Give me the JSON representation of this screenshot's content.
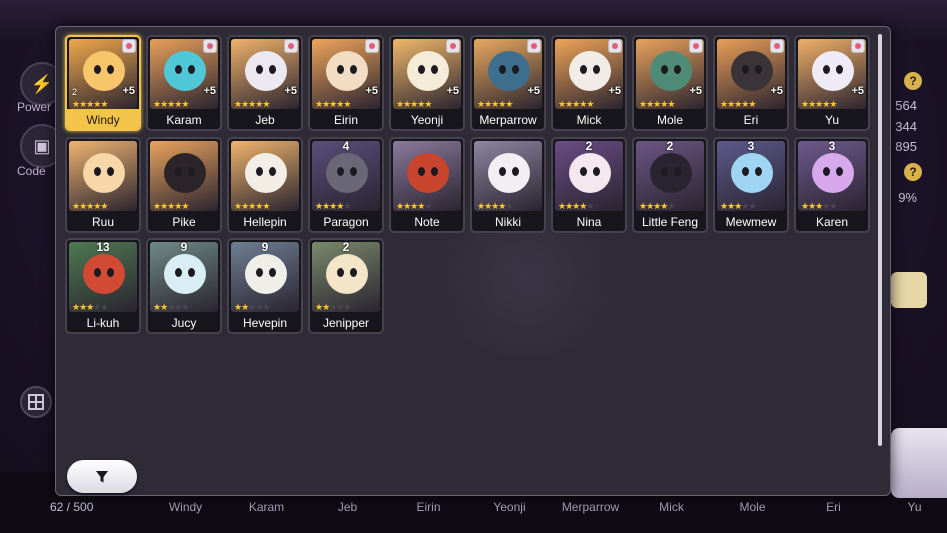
{
  "background": {
    "left_buttons": [
      {
        "label": "Power",
        "icon": "power-icon"
      },
      {
        "label": "Code",
        "icon": "code-icon"
      }
    ],
    "right_numbers": [
      "564",
      "344",
      "895",
      "9%"
    ],
    "roster_count": "62 / 500",
    "bottom_names": [
      "Windy",
      "Karam",
      "Jeb",
      "Eirin",
      "Yeonji",
      "Merparrow",
      "Mick",
      "Mole",
      "Eri",
      "Yu"
    ]
  },
  "filter_button": {
    "icon": "filter-icon"
  },
  "colors": {
    "panel": "#2e2b36",
    "accent": "#f3c44a",
    "star": "#f5c53a"
  },
  "pets": [
    {
      "name": "Windy",
      "stars": 5,
      "plus": "+5",
      "lvl": "2",
      "selected": true,
      "color": "#f0a84a",
      "face": "#f7c56a"
    },
    {
      "name": "Karam",
      "stars": 5,
      "plus": "+5",
      "color": "#e8a05a",
      "face": "#4fc7d6"
    },
    {
      "name": "Jeb",
      "stars": 5,
      "plus": "+5",
      "color": "#f0b26a",
      "face": "#ece8f0"
    },
    {
      "name": "Eirin",
      "stars": 5,
      "plus": "+5",
      "color": "#efa45a",
      "face": "#f2dcc4"
    },
    {
      "name": "Yeonji",
      "stars": 5,
      "plus": "+5",
      "color": "#f0b86a",
      "face": "#f4ecd8"
    },
    {
      "name": "Merparrow",
      "stars": 5,
      "plus": "+5",
      "color": "#e8a85e",
      "face": "#3f6f8f"
    },
    {
      "name": "Mick",
      "stars": 5,
      "plus": "+5",
      "color": "#efa458",
      "face": "#f2ece8"
    },
    {
      "name": "Mole",
      "stars": 5,
      "plus": "+5",
      "color": "#e9a25c",
      "face": "#4f8c78"
    },
    {
      "name": "Eri",
      "stars": 5,
      "plus": "+5",
      "color": "#ea9e58",
      "face": "#3a3438"
    },
    {
      "name": "Yu",
      "stars": 5,
      "plus": "+5",
      "color": "#f0b068",
      "face": "#eeeaf6"
    },
    {
      "name": "Ruu",
      "stars": 5,
      "color": "#efb470",
      "face": "#f7d6a8"
    },
    {
      "name": "Pike",
      "stars": 5,
      "color": "#e9a35e",
      "face": "#2b2428"
    },
    {
      "name": "Hellepin",
      "stars": 5,
      "color": "#f0b46c",
      "face": "#f2eee6"
    },
    {
      "name": "Paragon",
      "stars": 4,
      "count": "4",
      "color": "#5a4f7c",
      "face": "#6a6876"
    },
    {
      "name": "Note",
      "stars": 4,
      "color": "#8a7a9c",
      "face": "#c9452e"
    },
    {
      "name": "Nikki",
      "stars": 4,
      "color": "#8e86a2",
      "face": "#f1eef4"
    },
    {
      "name": "Nina",
      "stars": 4,
      "count": "2",
      "color": "#6b4c86",
      "face": "#f4e8ee"
    },
    {
      "name": "Little Feng",
      "stars": 4,
      "count": "2",
      "color": "#6c5684",
      "face": "#2a2430"
    },
    {
      "name": "Mewmew",
      "stars": 3,
      "count": "3",
      "color": "#5d5a8c",
      "face": "#9fd4f2"
    },
    {
      "name": "Karen",
      "stars": 3,
      "count": "3",
      "color": "#6e5a8e",
      "face": "#d7a8ec"
    },
    {
      "name": "Li-kuh",
      "stars": 3,
      "count": "13",
      "color": "#4f7a52",
      "face": "#d24a34"
    },
    {
      "name": "Jucy",
      "stars": 2,
      "count": "9",
      "color": "#6f8a86",
      "face": "#d8eef4"
    },
    {
      "name": "Hevepin",
      "stars": 2,
      "count": "9",
      "color": "#6f7f94",
      "face": "#f0eee8"
    },
    {
      "name": "Jenipper",
      "stars": 2,
      "count": "2",
      "color": "#7a8a6c",
      "face": "#f4e4c8"
    }
  ]
}
